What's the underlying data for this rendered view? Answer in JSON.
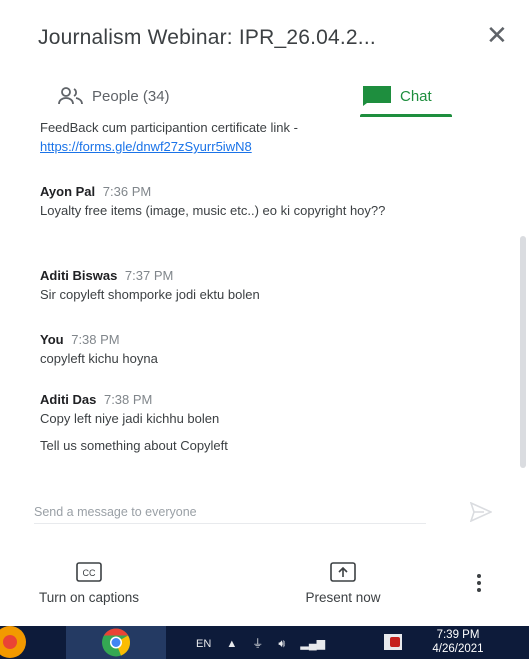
{
  "panel": {
    "title": "Journalism Webinar: IPR_26.04.2...",
    "close_icon": "close-icon"
  },
  "tabs": [
    {
      "label": "People (34)",
      "icon": "people-icon",
      "active": false
    },
    {
      "label": "Chat",
      "icon": "chat-icon",
      "active": true
    }
  ],
  "messages": [
    {
      "sender": "",
      "time": "",
      "text": "FeedBack cum participantion certificate link -",
      "link": "https://forms.gle/dnwf27zSyurr5iwN8"
    },
    {
      "sender": "Ayon Pal",
      "time": "7:36 PM",
      "text": "Loyalty free items (image, music etc..) eo ki copyright hoy??"
    },
    {
      "sender": "Aditi Biswas",
      "time": "7:37 PM",
      "text": "Sir copyleft shomporke jodi ektu bolen"
    },
    {
      "sender": "You",
      "time": "7:38 PM",
      "text": "copyleft kichu hoyna"
    },
    {
      "sender": "Aditi Das",
      "time": "7:38 PM",
      "text": "Copy left niye jadi kichhu bolen",
      "text2": "Tell us something about Copyleft"
    }
  ],
  "compose": {
    "placeholder": "Send a message to everyone",
    "value": ""
  },
  "controls": {
    "captions_label": "Turn on captions",
    "present_label": "Present now"
  },
  "taskbar": {
    "language": "EN",
    "time": "7:39 PM",
    "date": "4/26/2021"
  },
  "colors": {
    "accent": "#1e8e3e",
    "link": "#1a73e8",
    "text": "#3c4043",
    "taskbar": "#0d1b3a"
  }
}
